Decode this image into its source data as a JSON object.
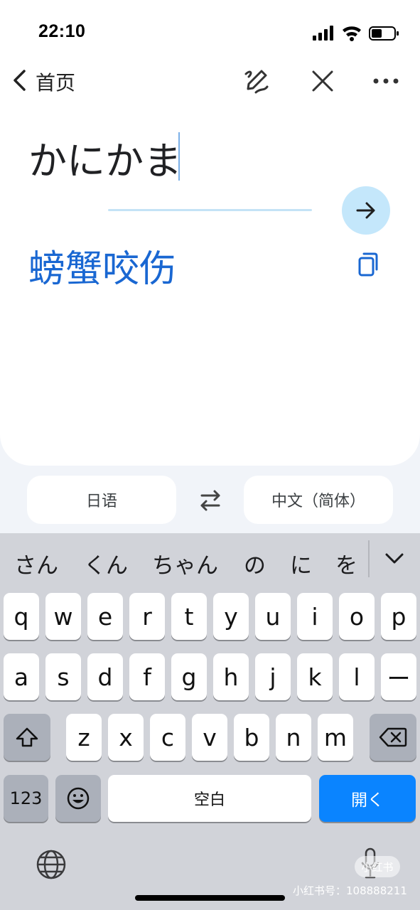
{
  "status_bar": {
    "time": "22:10"
  },
  "nav": {
    "back_label": "首页"
  },
  "translation": {
    "source_text": "かにかま",
    "result_text": "螃蟹咬伤"
  },
  "languages": {
    "source": "日语",
    "target": "中文（简体）"
  },
  "keyboard": {
    "suggestions": [
      "さん",
      "くん",
      "ちゃん",
      "の",
      "に",
      "を"
    ],
    "row1": [
      "q",
      "w",
      "e",
      "r",
      "t",
      "y",
      "u",
      "i",
      "o",
      "p"
    ],
    "row2": [
      "a",
      "s",
      "d",
      "f",
      "g",
      "h",
      "j",
      "k",
      "l",
      "ー"
    ],
    "row3": [
      "z",
      "x",
      "c",
      "v",
      "b",
      "n",
      "m"
    ],
    "num_label": "123",
    "space_label": "空白",
    "return_label": "開く"
  },
  "watermark": {
    "pill": "小红书",
    "text": "小红书号：108888211"
  },
  "colors": {
    "accent": "#1967d2",
    "go_button": "#c4e7fb",
    "keyboard_bg": "#d1d3d9",
    "return_key": "#0a84ff"
  },
  "icons": [
    "back-chevron-icon",
    "handwriting-pen-icon",
    "close-icon",
    "more-icon",
    "arrow-right-icon",
    "copy-icon",
    "swap-arrows-icon",
    "chevron-down-icon",
    "shift-icon",
    "backspace-icon",
    "emoji-icon",
    "globe-icon",
    "microphone-icon"
  ]
}
